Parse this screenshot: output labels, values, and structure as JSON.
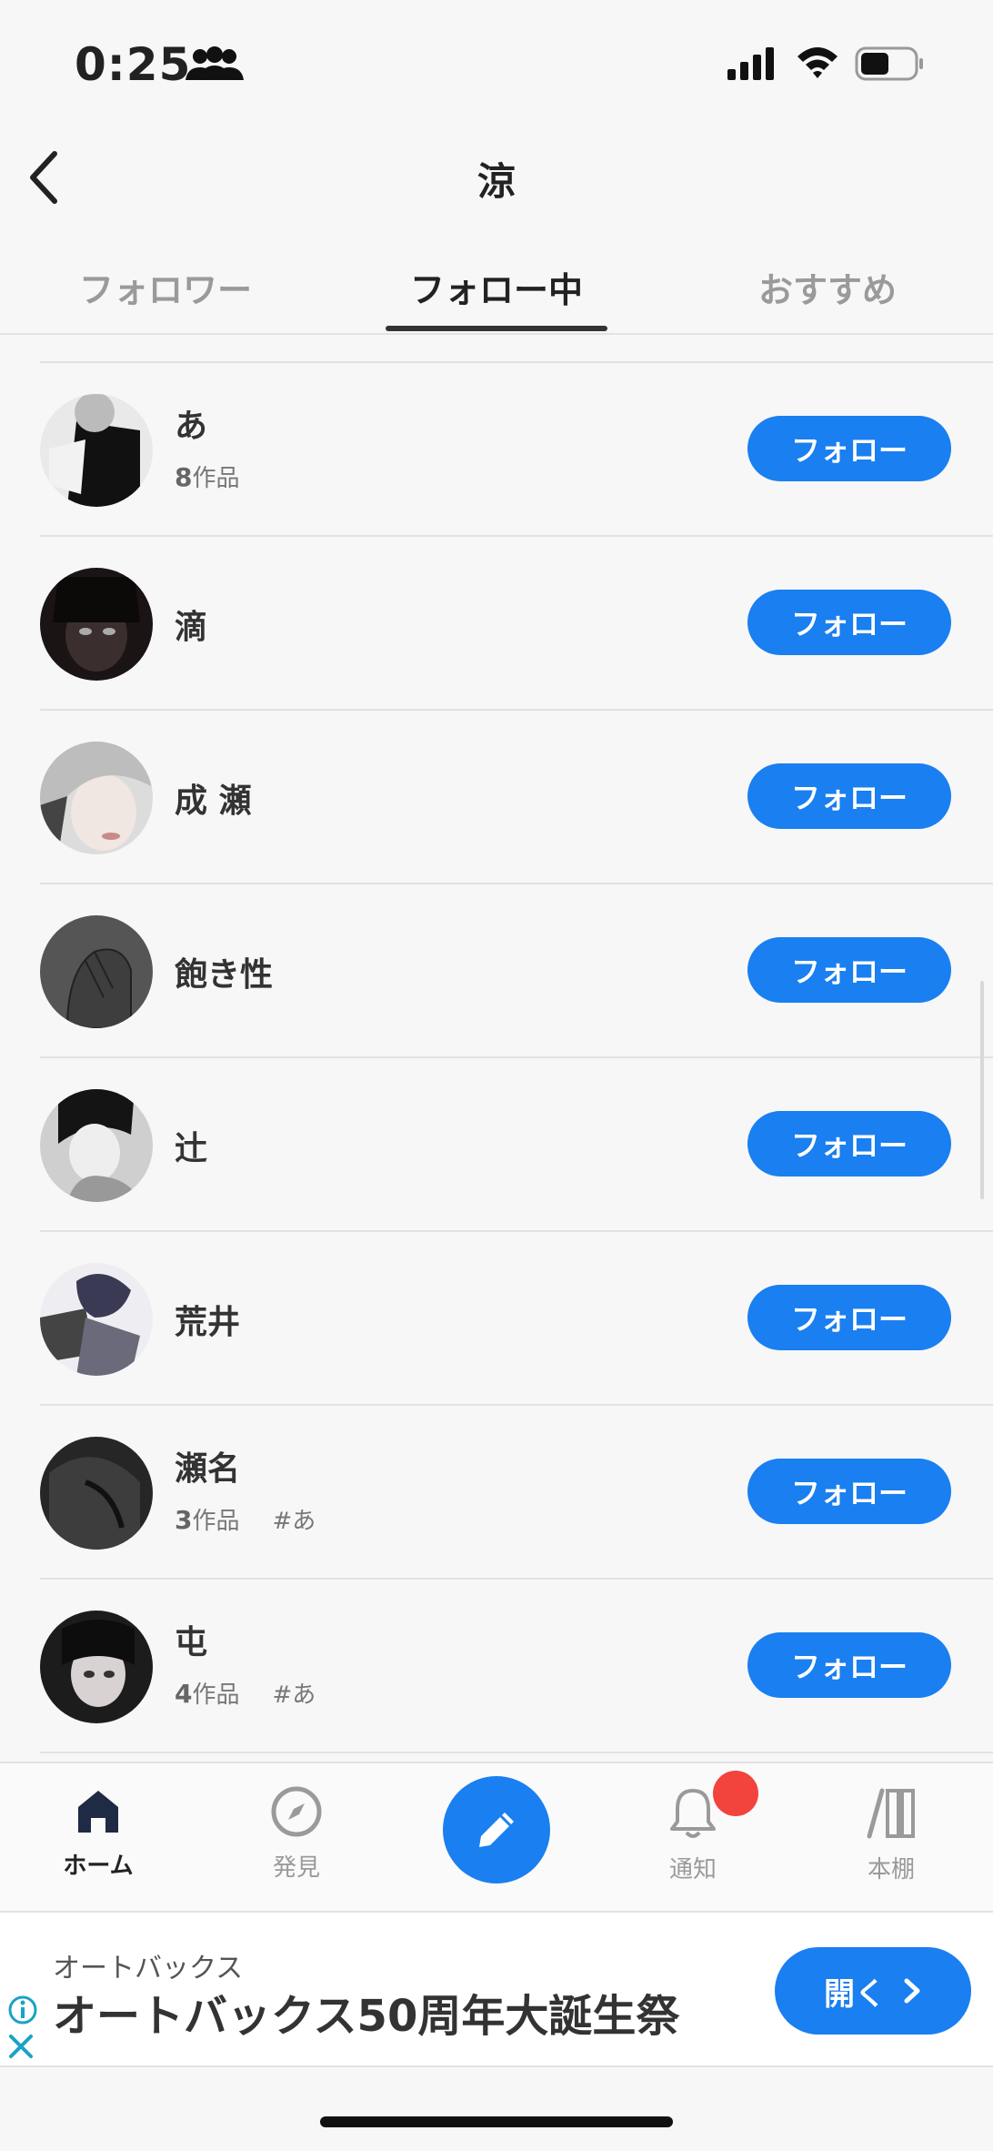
{
  "status_bar": {
    "time": "0:25",
    "icons": [
      "people-icon",
      "signal-icon",
      "wifi-icon",
      "battery-icon"
    ]
  },
  "header": {
    "title": "涼",
    "back_icon": "chevron-left-icon"
  },
  "tabs": [
    {
      "label": "フォロワー",
      "active": false
    },
    {
      "label": "フォロー中",
      "active": true
    },
    {
      "label": "おすすめ",
      "active": false
    }
  ],
  "users": [
    {
      "name": "あ",
      "works_count": "8",
      "works_suffix": "作品",
      "tag": "",
      "follow_label": "フォロー"
    },
    {
      "name": "滴",
      "works_count": "",
      "works_suffix": "",
      "tag": "",
      "follow_label": "フォロー"
    },
    {
      "name": "成 瀬",
      "works_count": "",
      "works_suffix": "",
      "tag": "",
      "follow_label": "フォロー"
    },
    {
      "name": "飽き性",
      "works_count": "",
      "works_suffix": "",
      "tag": "",
      "follow_label": "フォロー"
    },
    {
      "name": "辻",
      "works_count": "",
      "works_suffix": "",
      "tag": "",
      "follow_label": "フォロー"
    },
    {
      "name": "荒井",
      "works_count": "",
      "works_suffix": "",
      "tag": "",
      "follow_label": "フォロー"
    },
    {
      "name": "瀬名",
      "works_count": "3",
      "works_suffix": "作品",
      "tag": "#あ",
      "follow_label": "フォロー"
    },
    {
      "name": "屯",
      "works_count": "4",
      "works_suffix": "作品",
      "tag": "#あ",
      "follow_label": "フォロー"
    }
  ],
  "bottom_nav": {
    "items": [
      {
        "label": "ホーム",
        "icon": "home-icon",
        "active": true
      },
      {
        "label": "発見",
        "icon": "compass-icon",
        "active": false
      },
      {
        "label": "",
        "icon": "pencil-icon",
        "active": false
      },
      {
        "label": "通知",
        "icon": "bell-icon",
        "active": false
      },
      {
        "label": "本棚",
        "icon": "bookshelf-icon",
        "active": false
      }
    ]
  },
  "ad": {
    "advertiser": "オートバックス",
    "headline": "オートバックス50周年大誕生祭",
    "open_label": "開く"
  },
  "colors": {
    "accent": "#1a7ff0",
    "badge": "#f2433d",
    "background": "#f7f7f7"
  }
}
